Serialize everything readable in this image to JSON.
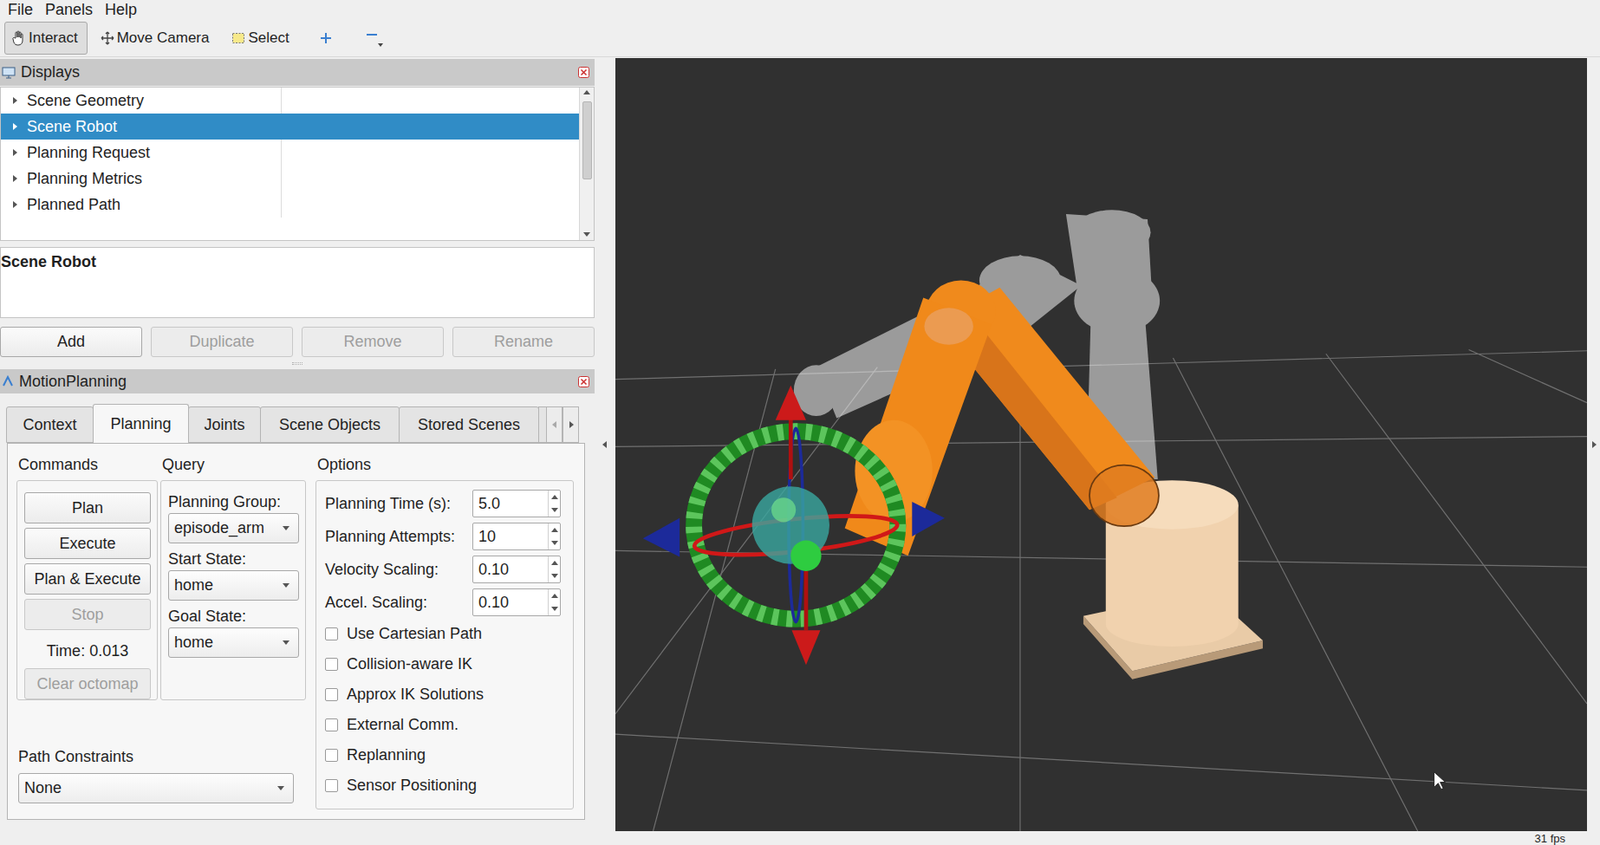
{
  "menu": [
    {
      "label": "File"
    },
    {
      "label": "Panels"
    },
    {
      "label": "Help"
    }
  ],
  "toolbar": {
    "tools": [
      {
        "label": "Interact",
        "selected": true,
        "kind": "hand"
      },
      {
        "label": "Move Camera",
        "selected": false,
        "kind": "camera"
      },
      {
        "label": "Select",
        "selected": false,
        "kind": "select"
      }
    ]
  },
  "displays": {
    "title": "Displays",
    "items": [
      {
        "label": "Scene Geometry",
        "selected": false,
        "expanded": false
      },
      {
        "label": "Scene Robot",
        "selected": true,
        "expanded": false
      },
      {
        "label": "Planning Request",
        "selected": false,
        "expanded": false
      },
      {
        "label": "Planning Metrics",
        "selected": false,
        "expanded": false
      },
      {
        "label": "Planned Path",
        "selected": false,
        "expanded": false
      }
    ]
  },
  "description": {
    "title": "Scene Robot"
  },
  "display_buttons": [
    {
      "label": "Add",
      "disabled": false
    },
    {
      "label": "Duplicate",
      "disabled": true
    },
    {
      "label": "Remove",
      "disabled": true
    },
    {
      "label": "Rename",
      "disabled": true
    }
  ],
  "motion_planning": {
    "title": "MotionPlanning",
    "tabs": [
      {
        "label": "Context",
        "selected": false
      },
      {
        "label": "Planning",
        "selected": true
      },
      {
        "label": "Joints",
        "selected": false
      },
      {
        "label": "Scene Objects",
        "selected": false
      },
      {
        "label": "Stored Scenes",
        "selected": false
      }
    ],
    "commands": {
      "title": "Commands",
      "buttons": [
        {
          "label": "Plan",
          "disabled": false
        },
        {
          "label": "Execute",
          "disabled": false
        },
        {
          "label": "Plan & Execute",
          "disabled": false
        },
        {
          "label": "Stop",
          "disabled": true
        }
      ],
      "time": "Time: 0.013",
      "clear_button": {
        "label": "Clear octomap",
        "disabled": true
      }
    },
    "query": {
      "title": "Query",
      "fields": [
        {
          "label": "Planning Group:",
          "value": "episode_arm"
        },
        {
          "label": "Start State:",
          "value": "home"
        },
        {
          "label": "Goal State:",
          "value": "home"
        }
      ]
    },
    "options": {
      "title": "Options",
      "spinboxes": [
        {
          "label": "Planning Time (s):",
          "value": "5.0"
        },
        {
          "label": "Planning Attempts:",
          "value": "10"
        },
        {
          "label": "Velocity Scaling:",
          "value": "0.10"
        },
        {
          "label": "Accel. Scaling:",
          "value": "0.10"
        }
      ],
      "checkboxes": [
        {
          "label": "Use Cartesian Path",
          "checked": false
        },
        {
          "label": "Collision-aware IK",
          "checked": false
        },
        {
          "label": "Approx IK Solutions",
          "checked": false
        },
        {
          "label": "External Comm.",
          "checked": false
        },
        {
          "label": "Replanning",
          "checked": false
        },
        {
          "label": "Sensor Positioning",
          "checked": false
        }
      ]
    },
    "path_constraints": {
      "label": "Path Constraints",
      "value": "None"
    }
  },
  "status_bar": {
    "fps": "31 fps"
  }
}
